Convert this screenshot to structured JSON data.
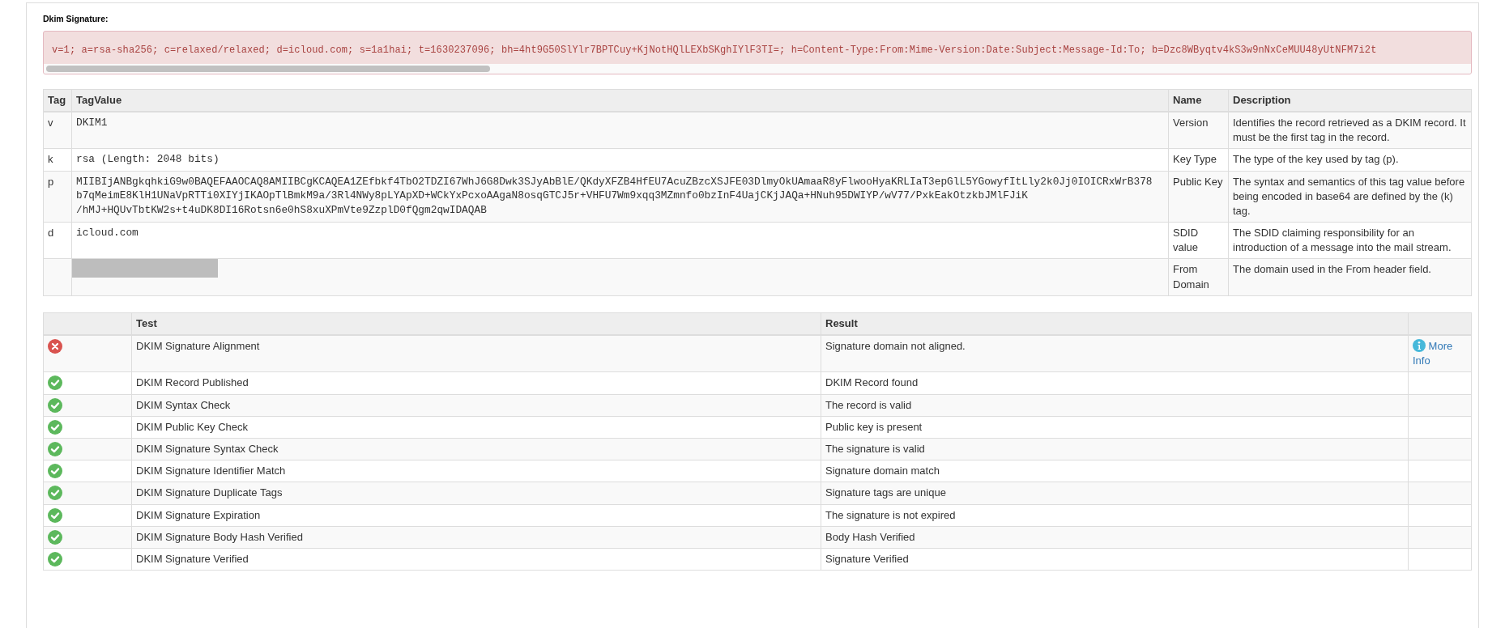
{
  "signature": {
    "label": "Dkim Signature:",
    "value": "v=1; a=rsa-sha256; c=relaxed/relaxed; d=icloud.com; s=1a1hai; t=1630237096; bh=4ht9G50SlYlr7BPTCuy+KjNotHQlLEXbSKghIYlF3TI=; h=Content-Type:From:Mime-Version:Date:Subject:Message-Id:To; b=Dzc8WByqtv4kS3w9nNxCeMUU48yUtNFM7i2t"
  },
  "tag_table": {
    "columns": [
      "Tag",
      "TagValue",
      "Name",
      "Description"
    ],
    "rows": [
      {
        "tag": "v",
        "value_lines": [
          "DKIM1"
        ],
        "name": "Version",
        "description": "Identifies the record retrieved as a DKIM record. It must be the first tag in the record."
      },
      {
        "tag": "k",
        "value_lines": [
          "rsa (Length: 2048 bits)"
        ],
        "name": "Key Type",
        "description": "The type of the key used by tag (p)."
      },
      {
        "tag": "p",
        "value_lines": [
          "MIIBIjANBgkqhkiG9w0BAQEFAAOCAQ8AMIIBCgKCAQEA1ZEfbkf4TbO2TDZI67WhJ6G8Dwk3SJyAbBlE/QKdyXFZB4HfEU7AcuZBzcXSJFE03DlmyOkUAmaaR8yFlwooHyaKRLIaT3epGlL5YGowyfItLly2k0Jj0IOICRxWrB378",
          "b7qMeimE8KlH1UNaVpRTTi0XIYjIKAOpTlBmkM9a/3Rl4NWy8pLYApXD+WCkYxPcxoAAgaN8osqGTCJ5r+VHFU7Wm9xqq3MZmnfo0bzInF4UajCKjJAQa+HNuh95DWIYP/wV77/PxkEakOtzkbJMlFJiK",
          "/hMJ+HQUvTbtKW2s+t4uDK8DI16Rotsn6e0hS8xuXPmVte9ZzplD0fQgm2qwIDAQAB"
        ],
        "name": "Public Key",
        "description": "The syntax and semantics of this tag value before being encoded in base64 are defined by the (k) tag."
      },
      {
        "tag": "d",
        "value_lines": [
          "icloud.com"
        ],
        "name": "SDID value",
        "description": "The SDID claiming responsibility for an introduction of a message into the mail stream."
      },
      {
        "redacted": true,
        "name": "From Domain",
        "description": "The domain used in the From header field."
      }
    ]
  },
  "test_table": {
    "columns": [
      "Test",
      "Result"
    ],
    "rows": [
      {
        "passed": false,
        "test": "DKIM Signature Alignment",
        "result": "Signature domain not aligned.",
        "link": "More Info"
      },
      {
        "passed": true,
        "test": "DKIM Record Published",
        "result": "DKIM Record found"
      },
      {
        "passed": true,
        "test": "DKIM Syntax Check",
        "result": "The record is valid"
      },
      {
        "passed": true,
        "test": "DKIM Public Key Check",
        "result": "Public key is present"
      },
      {
        "passed": true,
        "test": "DKIM Signature Syntax Check",
        "result": "The signature is valid"
      },
      {
        "passed": true,
        "test": "DKIM Signature Identifier Match",
        "result": "Signature domain match"
      },
      {
        "passed": true,
        "test": "DKIM Signature Duplicate Tags",
        "result": "Signature tags are unique"
      },
      {
        "passed": true,
        "test": "DKIM Signature Expiration",
        "result": "The signature is not expired"
      },
      {
        "passed": true,
        "test": "DKIM Signature Body Hash Verified",
        "result": "Body Hash Verified"
      },
      {
        "passed": true,
        "test": "DKIM Signature Verified",
        "result": "Signature Verified"
      }
    ]
  }
}
